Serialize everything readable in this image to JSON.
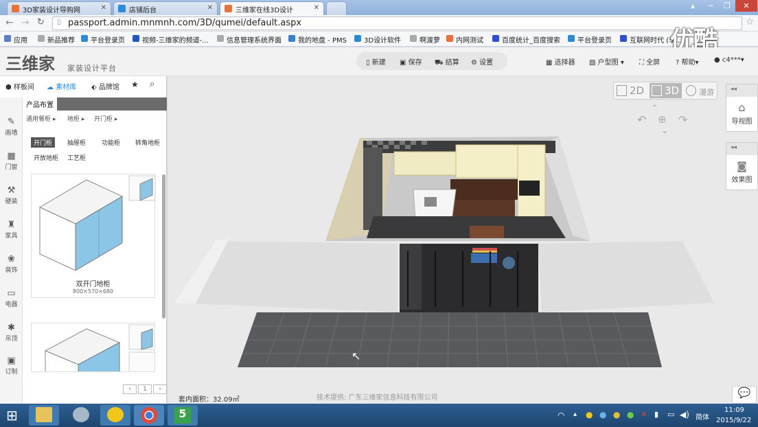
{
  "browser": {
    "tabs": [
      {
        "label": "3D家装设计导购网",
        "fav_color": "#e8713c"
      },
      {
        "label": "店铺后台",
        "fav_color": "#2d8ad6"
      },
      {
        "label": "三维家在线3D设计",
        "fav_color": "#e8713c"
      }
    ],
    "url": "passport.admin.mnmnh.com/3D/qumei/default.aspx",
    "bookmarks": [
      {
        "label": "应用",
        "color": "#5b7fc6"
      },
      {
        "label": "新品推荐",
        "color": "#aaa"
      },
      {
        "label": "平台登录页",
        "color": "#2d8ad6"
      },
      {
        "label": "视频-三维家的频道-...",
        "color": "#1b58c4"
      },
      {
        "label": "信息管理系统界面",
        "color": "#aaa"
      },
      {
        "label": "我的地盘 - PMS",
        "color": "#3a7fd6"
      },
      {
        "label": "3D设计软件",
        "color": "#2d8ad6"
      },
      {
        "label": "啊渡萝",
        "color": "#aaa"
      },
      {
        "label": "内网测试",
        "color": "#e8713c"
      },
      {
        "label": "百度统计_百度搜索",
        "color": "#2f4fd0"
      },
      {
        "label": "平台登录页",
        "color": "#2d8ad6"
      },
      {
        "label": "互联网时代 (李...",
        "color": "#2f4fd0"
      }
    ],
    "watermark": "优酷"
  },
  "header": {
    "logo": "三维家",
    "subtitle": "家装设计平台",
    "toolbar": [
      "新建",
      "保存",
      "结算",
      "设置"
    ],
    "right": [
      "选择器",
      "户型图",
      "全屏",
      "帮助",
      "c4***"
    ]
  },
  "left": {
    "tabs": [
      "样板间",
      "素材库",
      "品牌馆"
    ],
    "category": "产品布置",
    "breadcrumbs": [
      "通用餐柜 ▸",
      "地柜 ▸",
      "开门柜 ▸"
    ],
    "chips": [
      {
        "label": "开门柜",
        "selected": true
      },
      {
        "label": "抽屉柜",
        "selected": false
      },
      {
        "label": "功能柜",
        "selected": false
      },
      {
        "label": "转角地柜",
        "selected": false
      },
      {
        "label": "开放地柜",
        "selected": false
      },
      {
        "label": "工艺柜",
        "selected": false
      }
    ],
    "nav": [
      {
        "label": "画墙",
        "icon": "✎"
      },
      {
        "label": "门窗",
        "icon": "▦"
      },
      {
        "label": "硬装",
        "icon": "⚒"
      },
      {
        "label": "家具",
        "icon": "♜"
      },
      {
        "label": "装饰",
        "icon": "❀"
      },
      {
        "label": "电器",
        "icon": "▭"
      },
      {
        "label": "吊顶",
        "icon": "✱"
      },
      {
        "label": "订制",
        "icon": "▣"
      }
    ],
    "product": {
      "name": "双开门地柜",
      "dims": "800×570×680"
    },
    "page": "1"
  },
  "canvas": {
    "view_modes": [
      "2D",
      "3D",
      "漫游"
    ],
    "active_view": "3D",
    "right_panels": [
      "导视图",
      "效果图"
    ],
    "area_label": "套内面积：32.09㎡",
    "credit": "技术提供: 广东三维家信息科技有限公司"
  },
  "taskbar": {
    "lang": "简体",
    "time": "11:09",
    "date": "2015/9/22"
  }
}
